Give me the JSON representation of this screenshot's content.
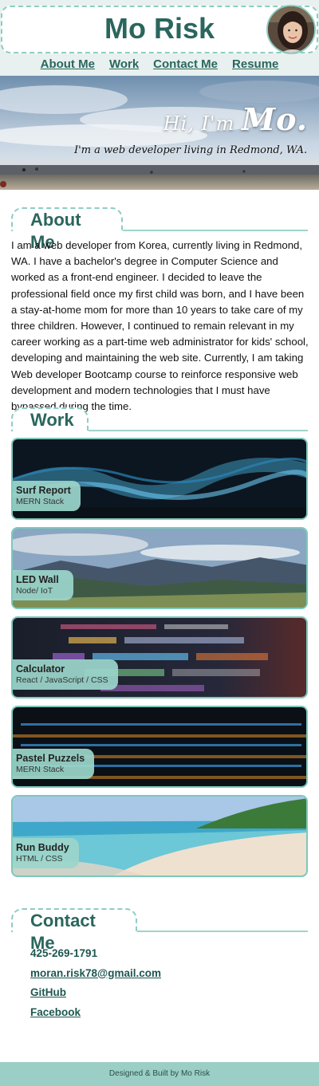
{
  "header": {
    "title": "Mo Risk"
  },
  "nav": {
    "items": [
      {
        "label": "About Me"
      },
      {
        "label": "Work"
      },
      {
        "label": "Contact Me"
      },
      {
        "label": "Resume"
      }
    ]
  },
  "hero": {
    "greeting": "Hi, I'm",
    "name": "Mo.",
    "tagline": "I'm a web developer living in Redmond, WA."
  },
  "about": {
    "heading": "About Me",
    "text": "I am a web developer from Korea, currently living in Redmond, WA. I have a bachelor's degree in Computer Science and worked as a front-end engineer. I decided to leave the professional field once my first child was born, and I have been a stay-at-home mom for more than 10 years to take care of my three children. However, I continued to remain relevant in my career working as a part-time web administrator for kids' school, developing and maintaining the web site. Currently, I am taking Web developer Bootcamp course to reinforce responsive web development and modern technologies that I must have bypassed during the time."
  },
  "work": {
    "heading": "Work",
    "projects": [
      {
        "title": "Surf Report",
        "stack": "MERN Stack"
      },
      {
        "title": "LED Wall",
        "stack": "Node/ IoT"
      },
      {
        "title": "Calculator",
        "stack": "React / JavaScript / CSS"
      },
      {
        "title": "Pastel Puzzels",
        "stack": "MERN Stack"
      },
      {
        "title": "Run Buddy",
        "stack": "HTML / CSS"
      }
    ]
  },
  "contact": {
    "heading": "Contact Me",
    "phone": "425-269-1791",
    "email": "moran.risk78@gmail.com",
    "github": "GitHub",
    "facebook": "Facebook"
  },
  "footer": {
    "text": "Designed & Built by Mo Risk"
  },
  "colors": {
    "accent": "#2a665d",
    "border": "#8ecdc2",
    "footer_bg": "#9bcfc6"
  }
}
